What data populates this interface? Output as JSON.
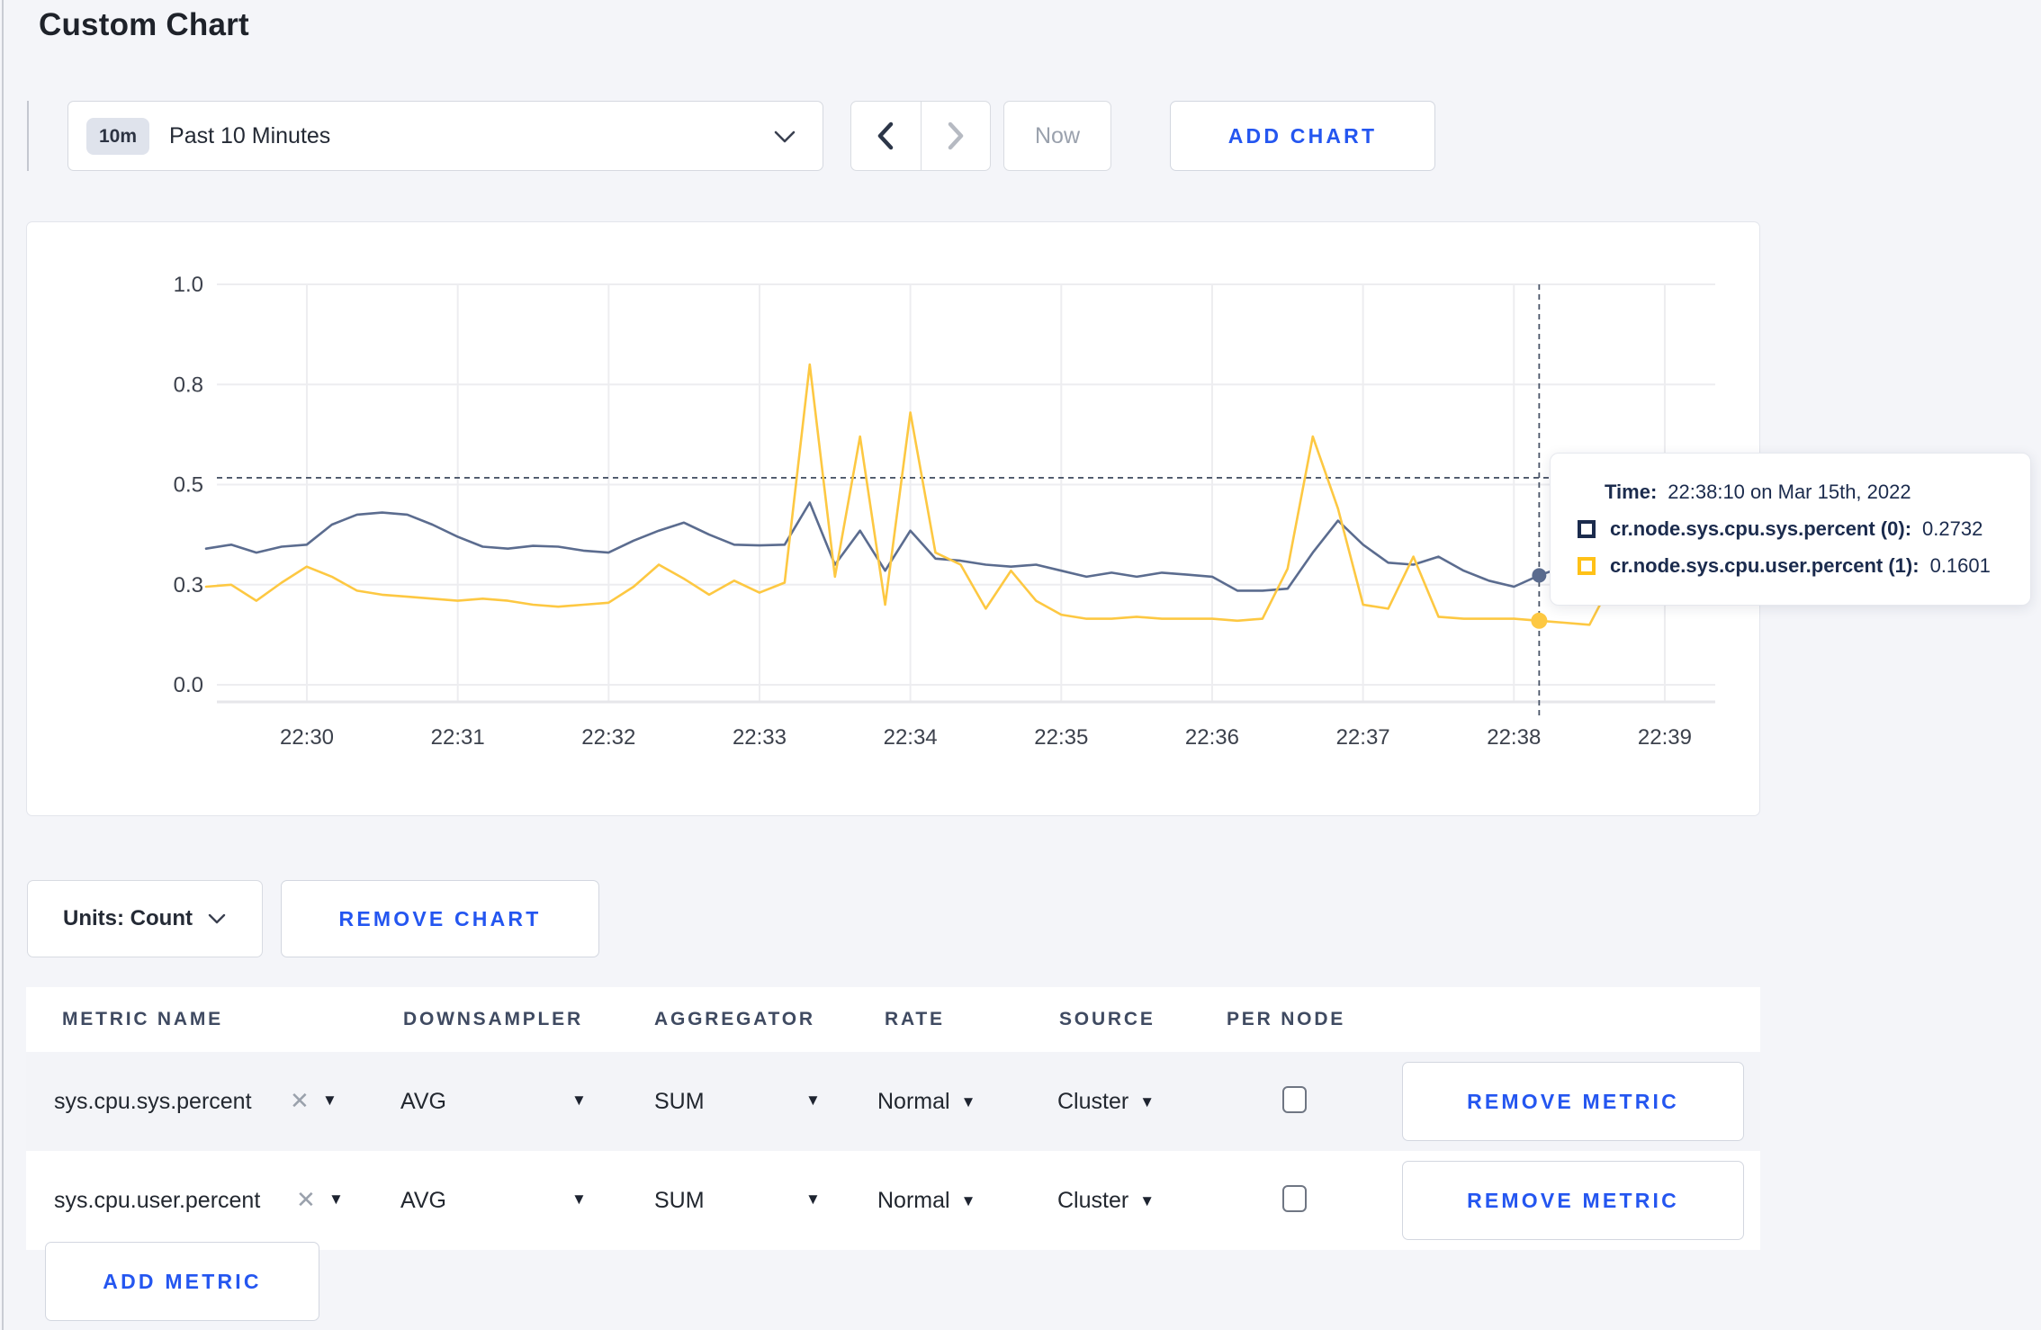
{
  "page": {
    "title": "Custom Chart"
  },
  "toolbar": {
    "range_badge": "10m",
    "range_label": "Past 10 Minutes",
    "now_label": "Now",
    "add_chart_label": "ADD CHART"
  },
  "chart_data": {
    "type": "line",
    "title": "",
    "x": [
      "22:29:20",
      "22:29:30",
      "22:29:40",
      "22:29:50",
      "22:30:00",
      "22:30:10",
      "22:30:20",
      "22:30:30",
      "22:30:40",
      "22:30:50",
      "22:31:00",
      "22:31:10",
      "22:31:20",
      "22:31:30",
      "22:31:40",
      "22:31:50",
      "22:32:00",
      "22:32:10",
      "22:32:20",
      "22:32:30",
      "22:32:40",
      "22:32:50",
      "22:33:00",
      "22:33:10",
      "22:33:20",
      "22:33:30",
      "22:33:40",
      "22:33:50",
      "22:34:00",
      "22:34:10",
      "22:34:20",
      "22:34:30",
      "22:34:40",
      "22:34:50",
      "22:35:00",
      "22:35:10",
      "22:35:20",
      "22:35:30",
      "22:35:40",
      "22:35:50",
      "22:36:00",
      "22:36:10",
      "22:36:20",
      "22:36:30",
      "22:36:40",
      "22:36:50",
      "22:37:00",
      "22:37:10",
      "22:37:20",
      "22:37:30",
      "22:37:40",
      "22:37:50",
      "22:38:00",
      "22:38:10",
      "22:38:20",
      "22:38:30",
      "22:38:40",
      "22:38:50",
      "22:39:00",
      "22:39:10"
    ],
    "series": [
      {
        "name": "cr.node.sys.cpu.sys.percent",
        "color": "#5b6c8f",
        "values": [
          0.34,
          0.35,
          0.33,
          0.345,
          0.35,
          0.4,
          0.425,
          0.43,
          0.425,
          0.4,
          0.37,
          0.345,
          0.34,
          0.347,
          0.345,
          0.335,
          0.33,
          0.36,
          0.385,
          0.405,
          0.375,
          0.35,
          0.348,
          0.35,
          0.455,
          0.3,
          0.385,
          0.285,
          0.385,
          0.315,
          0.31,
          0.3,
          0.295,
          0.3,
          0.285,
          0.27,
          0.28,
          0.27,
          0.28,
          0.275,
          0.27,
          0.235,
          0.235,
          0.24,
          0.33,
          0.41,
          0.35,
          0.305,
          0.3,
          0.32,
          0.285,
          0.26,
          0.245,
          0.2732,
          0.295,
          0.31,
          0.3,
          0.285,
          0.3,
          0.31
        ]
      },
      {
        "name": "cr.node.sys.cpu.user.percent",
        "color": "#fdc842",
        "values": [
          0.245,
          0.25,
          0.21,
          0.255,
          0.295,
          0.27,
          0.235,
          0.225,
          0.22,
          0.215,
          0.21,
          0.215,
          0.21,
          0.2,
          0.195,
          0.2,
          0.205,
          0.245,
          0.3,
          0.265,
          0.225,
          0.26,
          0.23,
          0.255,
          0.8,
          0.27,
          0.62,
          0.2,
          0.68,
          0.33,
          0.3,
          0.19,
          0.285,
          0.21,
          0.175,
          0.165,
          0.165,
          0.17,
          0.165,
          0.165,
          0.165,
          0.16,
          0.165,
          0.29,
          0.62,
          0.44,
          0.2,
          0.19,
          0.32,
          0.17,
          0.165,
          0.165,
          0.165,
          0.1601,
          0.155,
          0.15,
          0.27,
          0.235,
          0.215,
          0.27
        ]
      }
    ],
    "ylim": [
      0,
      1
    ],
    "yticks": [
      {
        "value": 0,
        "label": "0.0"
      },
      {
        "value": 0.25,
        "label": "0.3"
      },
      {
        "value": 0.5,
        "label": "0.5"
      },
      {
        "value": 0.75,
        "label": "0.8"
      },
      {
        "value": 1,
        "label": "1.0"
      }
    ],
    "xticks": [
      "22:30",
      "22:31",
      "22:32",
      "22:33",
      "22:34",
      "22:35",
      "22:36",
      "22:37",
      "22:38",
      "22:39"
    ],
    "grid": true,
    "legend_position": "tooltip",
    "hover": {
      "index": 53,
      "crosshair_y_value": 0.517
    }
  },
  "tooltip": {
    "time_label": "Time:",
    "time_value": "22:38:10 on Mar 15th, 2022",
    "series": [
      {
        "label": "cr.node.sys.cpu.sys.percent (0):",
        "value": "0.2732",
        "color": "#1b2b4d"
      },
      {
        "label": "cr.node.sys.cpu.user.percent (1):",
        "value": "0.1601",
        "color": "#ffc117"
      }
    ]
  },
  "chart_controls": {
    "units_label": "Units: Count",
    "remove_chart_label": "REMOVE CHART"
  },
  "metrics_table": {
    "headers": [
      "METRIC NAME",
      "DOWNSAMPLER",
      "AGGREGATOR",
      "RATE",
      "SOURCE",
      "PER NODE"
    ],
    "rows": [
      {
        "metric": "sys.cpu.sys.percent",
        "downsampler": "AVG",
        "aggregator": "SUM",
        "rate": "Normal",
        "source": "Cluster",
        "per_node_checked": false,
        "remove_label": "REMOVE METRIC"
      },
      {
        "metric": "sys.cpu.user.percent",
        "downsampler": "AVG",
        "aggregator": "SUM",
        "rate": "Normal",
        "source": "Cluster",
        "per_node_checked": false,
        "remove_label": "REMOVE METRIC"
      }
    ],
    "add_metric_label": "ADD METRIC"
  },
  "icons": {
    "close_x": "✕",
    "dropdown_triangle": "▼",
    "colors": {
      "accent_blue": "#2456f0",
      "navy": "#1b2b4d",
      "grid": "#ededf0",
      "page_bg": "#f4f5f9"
    }
  }
}
